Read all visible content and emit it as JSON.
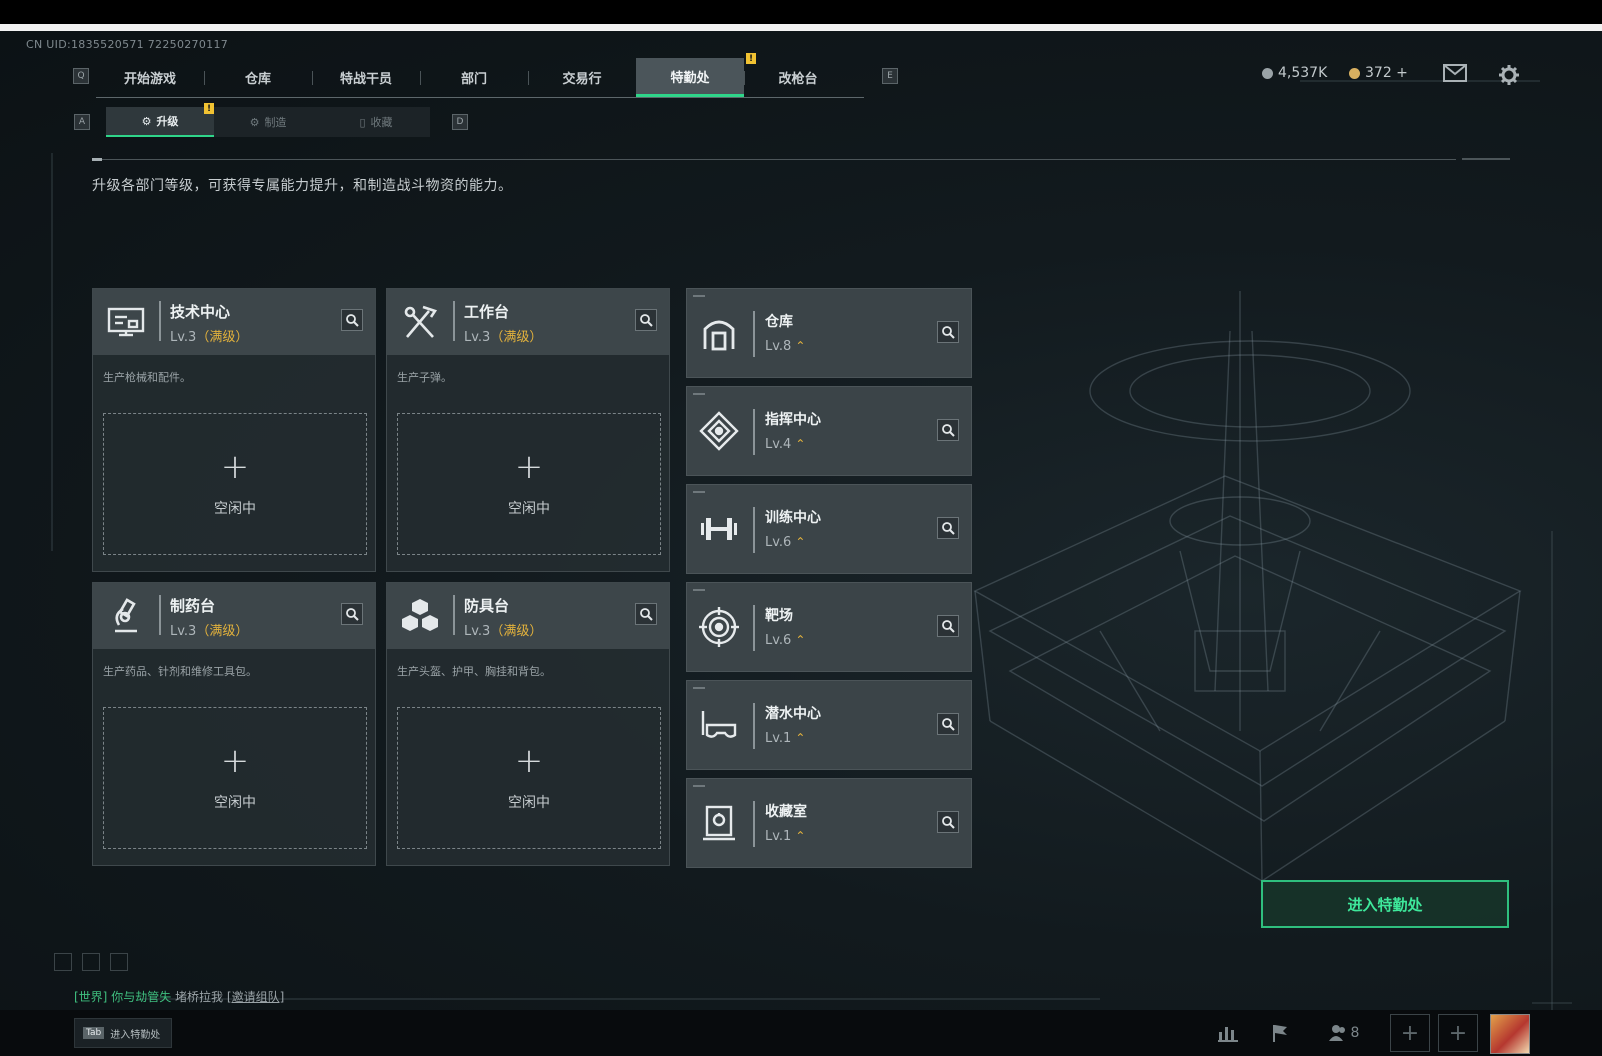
{
  "uid": "CN UID:1835520571 72250270117",
  "keys": {
    "prev_tab": "Q",
    "next_tab": "E",
    "prev_sub": "A",
    "next_sub": "D"
  },
  "tabs": [
    {
      "label": "开始游戏",
      "active": false
    },
    {
      "label": "仓库",
      "active": false
    },
    {
      "label": "特战干员",
      "active": false
    },
    {
      "label": "部门",
      "active": false
    },
    {
      "label": "交易行",
      "active": false
    },
    {
      "label": "特勤处",
      "active": true
    },
    {
      "label": "改枪台",
      "active": false
    }
  ],
  "badge": "!",
  "currencies": [
    {
      "value": "4,537K",
      "color": "#9aa3a7"
    },
    {
      "value": "372 +",
      "color": "#d8b060"
    }
  ],
  "top_icons": [
    "mail-icon",
    "gear-icon"
  ],
  "subtabs": [
    {
      "label": "升级",
      "icon": "upgrade-icon",
      "active": true
    },
    {
      "label": "制造",
      "icon": "craft-icon",
      "active": false
    },
    {
      "label": "收藏",
      "icon": "collect-icon",
      "active": false
    }
  ],
  "description": "升级各部门等级，可获得专属能力提升，和制造战斗物资的能力。",
  "cards": [
    {
      "name": "技术中心",
      "level": "Lv.3",
      "max": "（满级）",
      "icon": "monitor-icon",
      "desc": "生产枪械和配件。",
      "idle_plus": "+",
      "idle_label": "空闲中"
    },
    {
      "name": "工作台",
      "level": "Lv.3",
      "max": "（满级）",
      "icon": "tools-icon",
      "desc": "生产子弹。",
      "idle_plus": "+",
      "idle_label": "空闲中"
    },
    {
      "name": "制药台",
      "level": "Lv.3",
      "max": "（满级）",
      "icon": "microscope-icon",
      "desc": "生产药品、针剂和维修工具包。",
      "idle_plus": "+",
      "idle_label": "空闲中"
    },
    {
      "name": "防具台",
      "level": "Lv.3",
      "max": "（满级）",
      "icon": "armor-icon",
      "desc": "生产头盔、护甲、胸挂和背包。",
      "idle_plus": "+",
      "idle_label": "空闲中"
    }
  ],
  "facilities": [
    {
      "name": "仓库",
      "level": "Lv.8",
      "icon": "vault-icon"
    },
    {
      "name": "指挥中心",
      "level": "Lv.4",
      "icon": "command-icon"
    },
    {
      "name": "训练中心",
      "level": "Lv.6",
      "icon": "dumbbell-icon"
    },
    {
      "name": "靶场",
      "level": "Lv.6",
      "icon": "target-icon"
    },
    {
      "name": "潜水中心",
      "level": "Lv.1",
      "icon": "diving-icon"
    },
    {
      "name": "收藏室",
      "level": "Lv.1",
      "icon": "collection-icon"
    }
  ],
  "upgrade_arrow": "⌃",
  "enter_button": "进入特勤处",
  "chat": {
    "channel": "[世界]",
    "sender": "你与劫管失",
    "message": "堵桥拉我",
    "link": "[邀请组队]"
  },
  "tab_hint": {
    "key": "Tab",
    "label": "进入特勤处"
  },
  "bottom": {
    "friend_count": "8"
  }
}
